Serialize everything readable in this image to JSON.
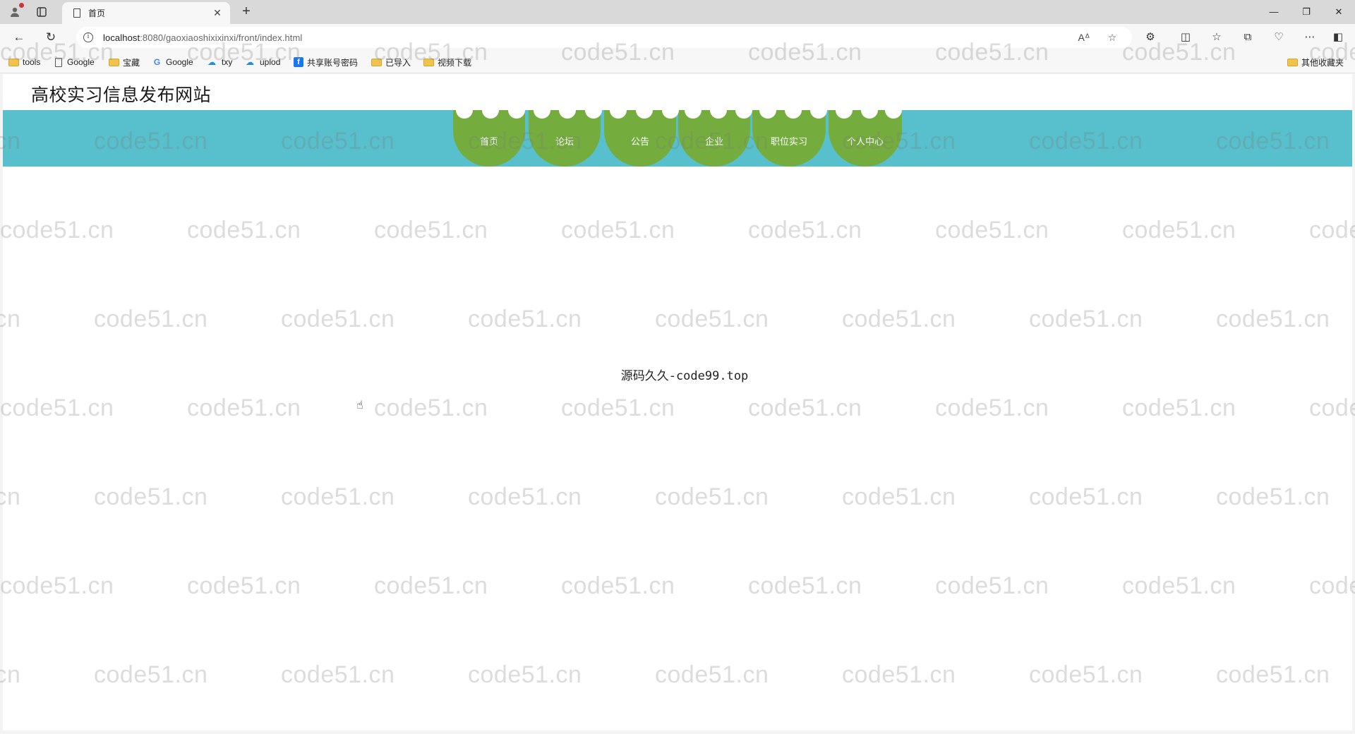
{
  "browser": {
    "tab_title": "首页",
    "url_host": "localhost",
    "url_rest": ":8080/gaoxiaoshixixinxi/front/index.html",
    "bookmarks": [
      {
        "label": "tools",
        "icon": "folder-icon"
      },
      {
        "label": "Google",
        "icon": "page-icon"
      },
      {
        "label": "宝藏",
        "icon": "folder-icon"
      },
      {
        "label": "Google",
        "icon": "google-icon"
      },
      {
        "label": "txy",
        "icon": "cloud-icon"
      },
      {
        "label": "uplod",
        "icon": "cloud-icon"
      },
      {
        "label": "共享账号密码",
        "icon": "facebook-icon"
      },
      {
        "label": "已导入",
        "icon": "folder-icon"
      },
      {
        "label": "视频下载",
        "icon": "folder-icon"
      }
    ],
    "other_bookmarks": "其他收藏夹"
  },
  "site": {
    "title": "高校实习信息发布网站",
    "nav": [
      {
        "label": "首页"
      },
      {
        "label": "论坛"
      },
      {
        "label": "公告"
      },
      {
        "label": "企业"
      },
      {
        "label": "职位实习"
      },
      {
        "label": "个人中心"
      }
    ],
    "center_text": "源码久久-code99.top"
  },
  "watermark": "code51.cn",
  "colors": {
    "nav_band": "#58c0cc",
    "nav_item": "#74ad3e"
  }
}
